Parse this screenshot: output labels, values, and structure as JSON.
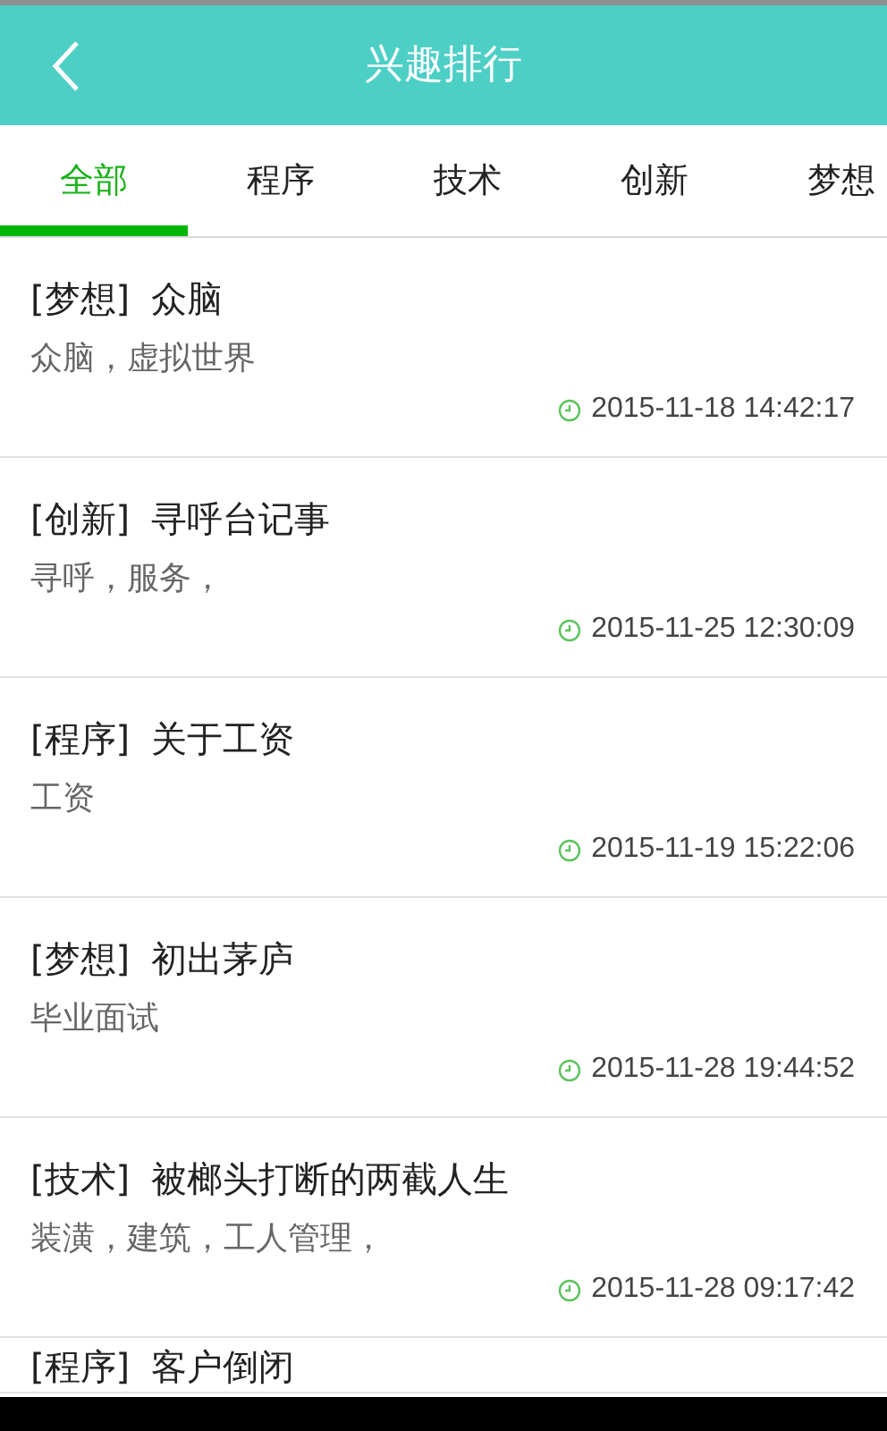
{
  "header": {
    "title": "兴趣排行"
  },
  "tabs": [
    {
      "label": "全部",
      "selected": true
    },
    {
      "label": "程序",
      "selected": false
    },
    {
      "label": "技术",
      "selected": false
    },
    {
      "label": "创新",
      "selected": false
    },
    {
      "label": "梦想",
      "selected": false
    }
  ],
  "items": [
    {
      "category": "[梦想]",
      "title": "众脑",
      "tags": "众脑，虚拟世界",
      "time": "2015-11-18 14:42:17"
    },
    {
      "category": "[创新]",
      "title": "寻呼台记事",
      "tags": "寻呼，服务，",
      "time": "2015-11-25 12:30:09"
    },
    {
      "category": "[程序]",
      "title": "关于工资",
      "tags": "工资",
      "time": "2015-11-19 15:22:06"
    },
    {
      "category": "[梦想]",
      "title": "初出茅庐",
      "tags": "毕业面试",
      "time": "2015-11-28 19:44:52"
    },
    {
      "category": "[技术]",
      "title": "被榔头打断的两截人生",
      "tags": "装潢，建筑，工人管理，",
      "time": "2015-11-28 09:17:42"
    },
    {
      "category": "[程序]",
      "title": "客户倒闭"
    }
  ]
}
